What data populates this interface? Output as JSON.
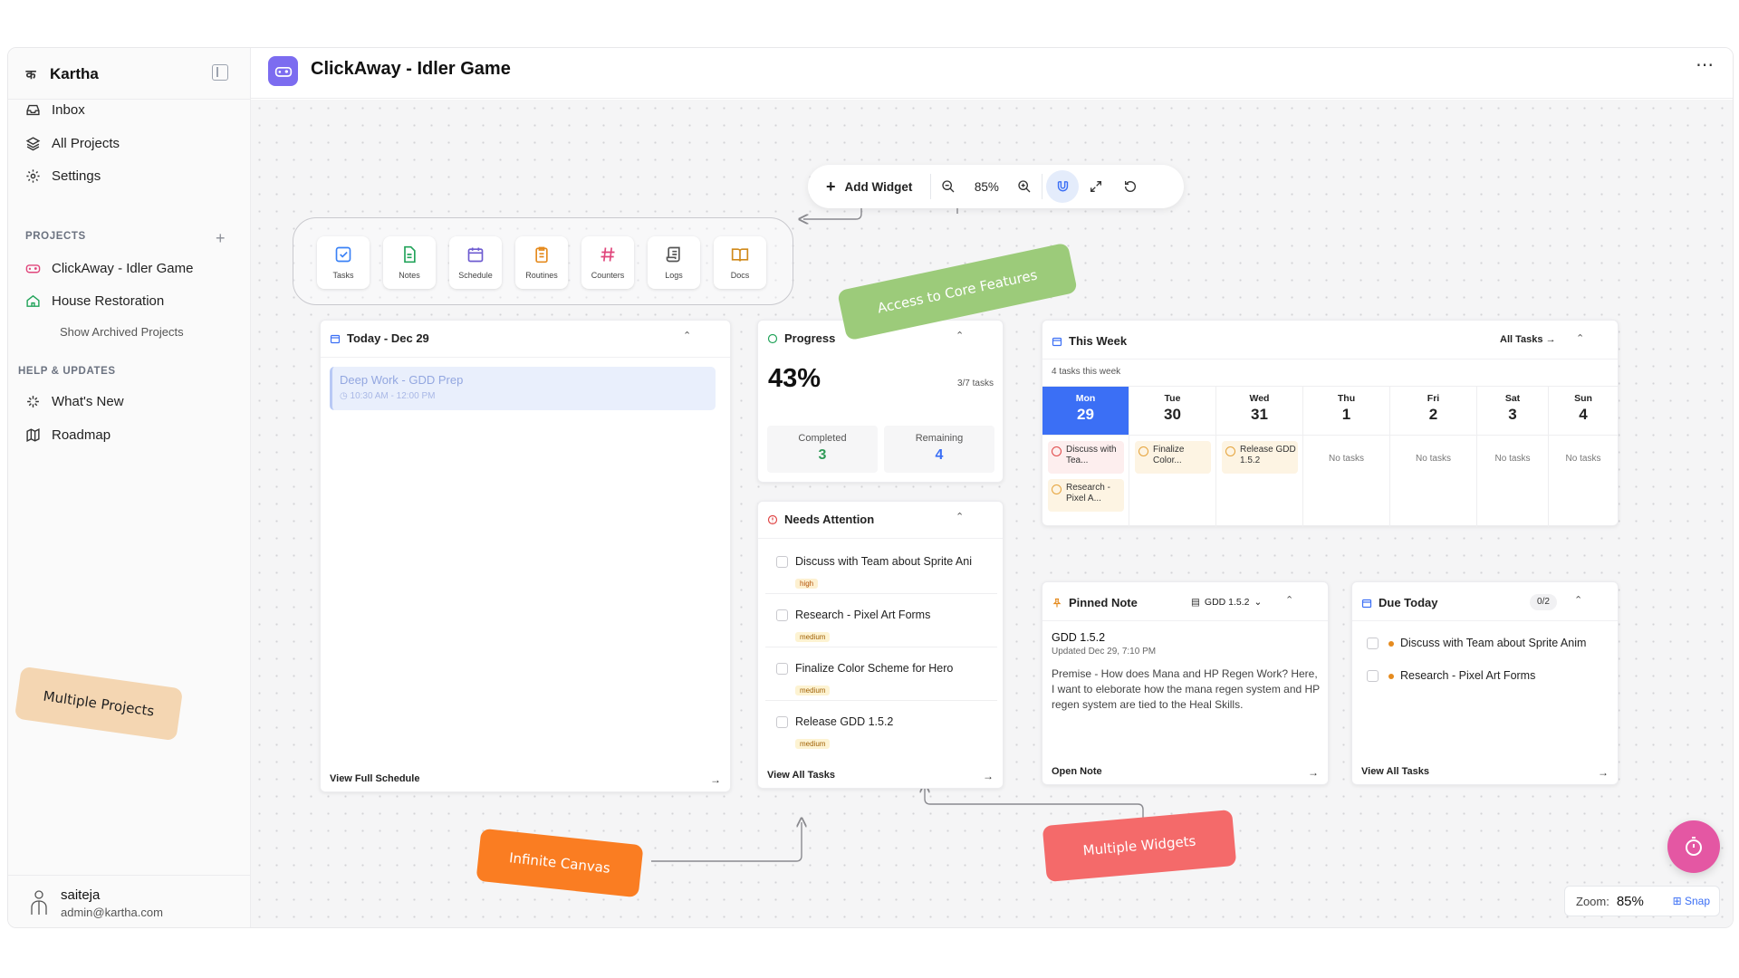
{
  "sidebar": {
    "brand": "Kartha",
    "brand_mark": "क",
    "nav": [
      {
        "label": "Inbox",
        "icon": "inbox-icon"
      },
      {
        "label": "All Projects",
        "icon": "layers-icon"
      },
      {
        "label": "Settings",
        "icon": "gear-icon"
      }
    ],
    "projects_label": "PROJECTS",
    "projects": [
      {
        "label": "ClickAway - Idler Game",
        "icon": "gamepad-icon"
      },
      {
        "label": "House Restoration",
        "icon": "home-icon"
      }
    ],
    "show_archived": "Show Archived Projects",
    "help_label": "HELP & UPDATES",
    "help": [
      {
        "label": "What's New",
        "icon": "sparkle-icon"
      },
      {
        "label": "Roadmap",
        "icon": "map-icon"
      }
    ],
    "user": {
      "name": "saiteja",
      "email": "admin@kartha.com"
    }
  },
  "header": {
    "title": "ClickAway - Idler Game",
    "more": "⋯"
  },
  "toolbar": {
    "add_widget": "Add Widget",
    "zoom": "85%"
  },
  "features": [
    {
      "label": "Tasks",
      "color": "#3b82f6",
      "bg": "#e8f0fe",
      "icon": "tasks-icon"
    },
    {
      "label": "Notes",
      "color": "#22a35a",
      "bg": "#e6f6ec",
      "icon": "notes-icon"
    },
    {
      "label": "Schedule",
      "color": "#6d5bd0",
      "bg": "#eeebfb",
      "icon": "calendar-icon"
    },
    {
      "label": "Routines",
      "color": "#e58b1f",
      "bg": "#fdf0de",
      "icon": "clipboard-icon"
    },
    {
      "label": "Counters",
      "color": "#e0457b",
      "bg": "#fde7ef",
      "icon": "hash-icon"
    },
    {
      "label": "Logs",
      "color": "#555555",
      "bg": "#eeeeef",
      "icon": "scroll-icon"
    },
    {
      "label": "Docs",
      "color": "#d08a1a",
      "bg": "#fcf1dc",
      "icon": "book-icon"
    }
  ],
  "today": {
    "title": "Today - Dec 29",
    "event_title": "Deep Work - GDD Prep",
    "event_time": "10:30 AM - 12:00 PM",
    "footer": "View Full Schedule"
  },
  "progress": {
    "title": "Progress",
    "percent": "43%",
    "tasks": "3/7 tasks",
    "completed_label": "Completed",
    "completed": "3",
    "remaining_label": "Remaining",
    "remaining": "4"
  },
  "attention": {
    "title": "Needs Attention",
    "items": [
      {
        "label": "Discuss with Team about Sprite Ani",
        "priority": "high"
      },
      {
        "label": "Research - Pixel Art Forms",
        "priority": "medium"
      },
      {
        "label": "Finalize Color Scheme for Hero",
        "priority": "medium"
      },
      {
        "label": "Release GDD 1.5.2",
        "priority": "medium"
      }
    ],
    "footer": "View All Tasks"
  },
  "week": {
    "title": "This Week",
    "filter": "All Tasks",
    "count": "4 tasks this week",
    "days": [
      {
        "dow": "Mon",
        "num": "29",
        "tasks": [
          "Discuss with Tea...",
          "Research - Pixel A..."
        ],
        "empty": ""
      },
      {
        "dow": "Tue",
        "num": "30",
        "tasks": [
          "Finalize Color..."
        ],
        "empty": ""
      },
      {
        "dow": "Wed",
        "num": "31",
        "tasks": [
          "Release GDD 1.5.2"
        ],
        "empty": ""
      },
      {
        "dow": "Thu",
        "num": "1",
        "tasks": [],
        "empty": "No tasks"
      },
      {
        "dow": "Fri",
        "num": "2",
        "tasks": [],
        "empty": "No tasks"
      },
      {
        "dow": "Sat",
        "num": "3",
        "tasks": [],
        "empty": "No tasks"
      },
      {
        "dow": "Sun",
        "num": "4",
        "tasks": [],
        "empty": "No tasks"
      }
    ]
  },
  "pinned": {
    "title": "Pinned Note",
    "doc": "GDD 1.5.2",
    "note_title": "GDD 1.5.2",
    "updated": "Updated Dec 29, 7:10 PM",
    "body": "Premise - How does Mana and HP Regen Work? Here, I want to eleborate how the mana regen system and HP regen system are tied to the Heal Skills.",
    "footer": "Open Note"
  },
  "due": {
    "title": "Due Today",
    "count": "0/2",
    "items": [
      "Discuss with Team about Sprite Anim",
      "Research - Pixel Art Forms"
    ],
    "footer": "View All Tasks"
  },
  "annotations": {
    "core": "Access to Core Features",
    "projects": "Multiple Projects",
    "canvas": "Infinite Canvas",
    "widgets": "Multiple Widgets"
  },
  "zoombar": {
    "label": "Zoom:",
    "value": "85%",
    "snap": "Snap"
  },
  "colors": {
    "accent": "#3b6ff5",
    "brand": "#7c6cf0",
    "fab": "#e457a3"
  }
}
